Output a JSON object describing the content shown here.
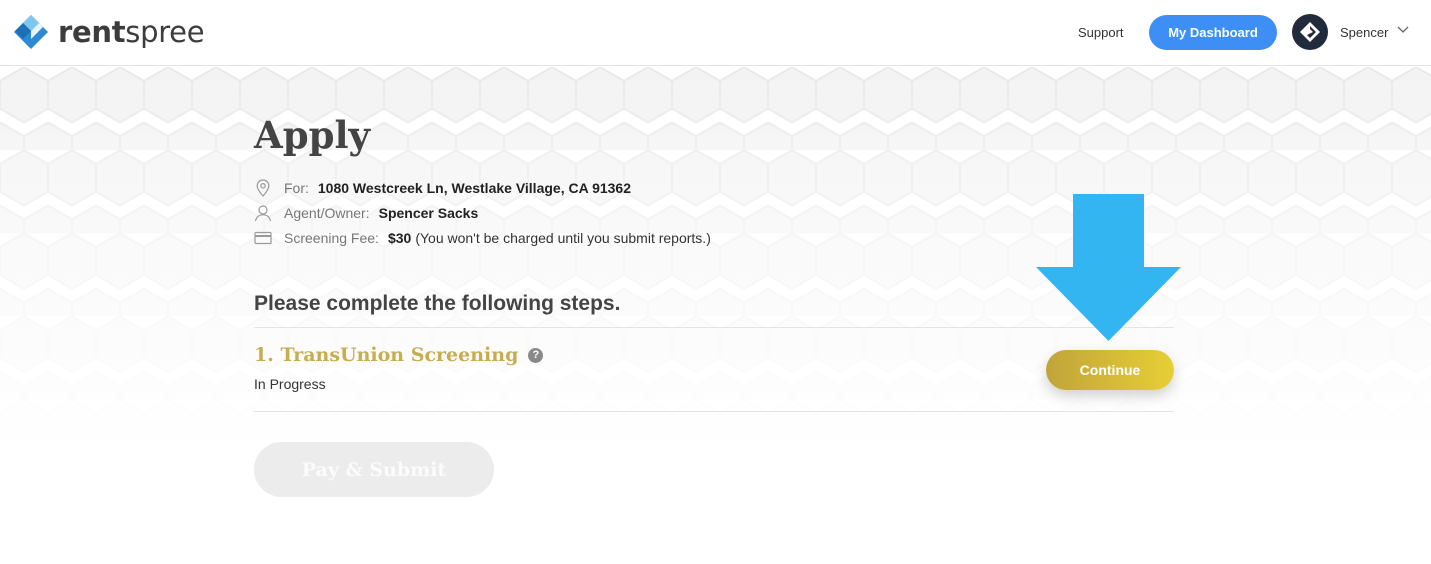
{
  "header": {
    "logo_text_bold": "rent",
    "logo_text_light": "spree",
    "support_label": "Support",
    "dashboard_label": "My Dashboard",
    "user_name": "Spencer"
  },
  "page": {
    "title": "Apply",
    "info": {
      "for_label": "For:",
      "for_value": "1080 Westcreek Ln, Westlake Village, CA 91362",
      "agent_label": "Agent/Owner:",
      "agent_value": "Spencer Sacks",
      "fee_label": "Screening Fee:",
      "fee_value": "$30",
      "fee_note": "(You won't be charged until you submit reports.)"
    },
    "steps_heading": "Please complete the following steps.",
    "step": {
      "title": "1. TransUnion Screening",
      "status": "In Progress",
      "continue_label": "Continue"
    },
    "pay_submit_label": "Pay & Submit"
  },
  "colors": {
    "primary_blue": "#3d8ff5",
    "gold": "#c8ad50",
    "arrow_blue": "#33b5f2",
    "avatar_bg": "#222b3c"
  }
}
